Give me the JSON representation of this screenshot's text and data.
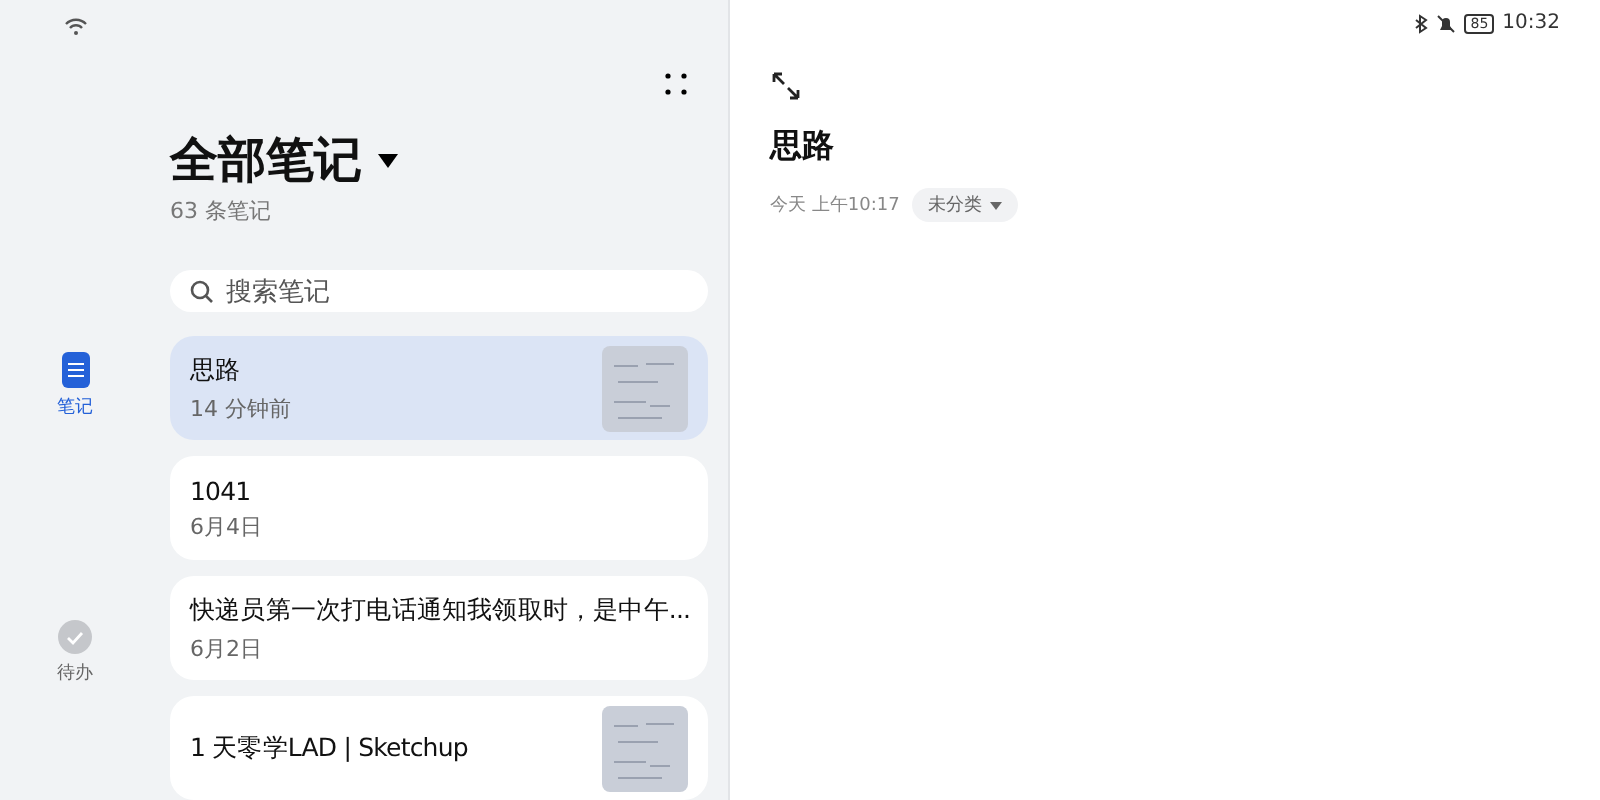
{
  "status_bar": {
    "battery": "85",
    "time": "10:32"
  },
  "nav": [
    {
      "label": "笔记",
      "kind": "notes",
      "selected": true
    },
    {
      "label": "待办",
      "kind": "todo",
      "selected": false
    }
  ],
  "list_header": {
    "title": "全部笔记",
    "count": "63 条笔记"
  },
  "search": {
    "placeholder": "搜索笔记"
  },
  "notes": [
    {
      "title": "思路",
      "time": "14 分钟前",
      "selected": true,
      "thumbnail": true
    },
    {
      "title": "1041",
      "time": "6月4日",
      "selected": false,
      "thumbnail": false
    },
    {
      "title": "快递员第一次打电话通知我领取时，是中午...",
      "time": "6月2日",
      "selected": false,
      "thumbnail": false
    },
    {
      "title": "1 天零学LAD | Sketchup",
      "selected": false,
      "thumbnail": true
    }
  ],
  "detail": {
    "title": "思路",
    "date": "今天 上午10:17",
    "category": "未分类"
  }
}
